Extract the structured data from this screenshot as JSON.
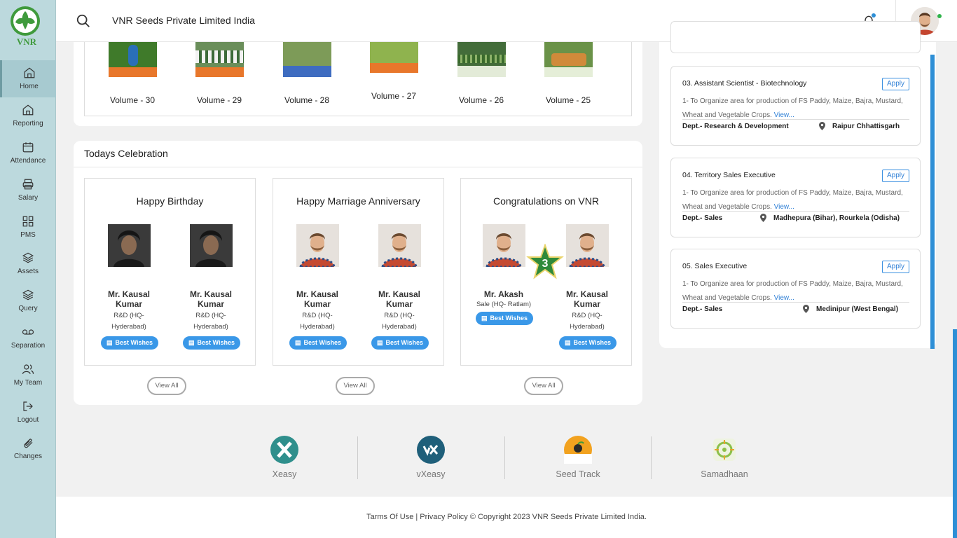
{
  "app": {
    "logo_text": "VNR",
    "company_name": "VNR Seeds Private Limited India"
  },
  "nav": [
    {
      "label": "Home",
      "icon": "home-icon"
    },
    {
      "label": "Reporting",
      "icon": "home-icon"
    },
    {
      "label": "Attendance",
      "icon": "calendar-icon"
    },
    {
      "label": "Salary",
      "icon": "printer-icon"
    },
    {
      "label": "PMS",
      "icon": "grid-icon"
    },
    {
      "label": "Assets",
      "icon": "layers-icon"
    },
    {
      "label": "Query",
      "icon": "layers-icon"
    },
    {
      "label": "Separation",
      "icon": "voicemail-icon"
    },
    {
      "label": "My Team",
      "icon": "users-icon"
    },
    {
      "label": "Logout",
      "icon": "logout-icon"
    },
    {
      "label": "Changes",
      "icon": "paperclip-icon"
    }
  ],
  "magazines": [
    {
      "label": "Volume - 30"
    },
    {
      "label": "Volume - 29"
    },
    {
      "label": "Volume - 28"
    },
    {
      "label": "Volume - 27"
    },
    {
      "label": "Volume - 26"
    },
    {
      "label": "Volume - 25"
    }
  ],
  "celebration": {
    "title": "Todays Celebration",
    "wish_label": "Best Wishes",
    "view_all": "View All",
    "badge_number": "3",
    "boxes": [
      {
        "heading": "Happy Birthday",
        "people": [
          {
            "name": "Mr. Kausal Kumar",
            "dept": "R&D (HQ-Hyderabad)"
          },
          {
            "name": "Mr. Kausal Kumar",
            "dept": "R&D (HQ-Hyderabad)"
          }
        ]
      },
      {
        "heading": "Happy Marriage Anniversary",
        "people": [
          {
            "name": "Mr. Kausal Kumar",
            "dept": "R&D (HQ-Hyderabad)"
          },
          {
            "name": "Mr. Kausal Kumar",
            "dept": "R&D (HQ-Hyderabad)"
          }
        ]
      },
      {
        "heading": "Congratulations on VNR",
        "people": [
          {
            "name": "Mr. Akash",
            "dept": "Sale (HQ- Ratlam)"
          },
          {
            "name": "Mr. Kausal Kumar",
            "dept": "R&D (HQ-Hyderabad)"
          }
        ]
      }
    ]
  },
  "jobs": [
    {
      "title": "03. Assistant Scientist - Biotechnology",
      "apply": "Apply",
      "desc": "1- To Organize area for production of FS Paddy, Maize, Bajra, Mustard, Wheat and Vegetable Crops.",
      "view": "View...",
      "dept": "Dept.- Research & Development",
      "location": "Raipur Chhattisgarh"
    },
    {
      "title": "04. Territory Sales Executive",
      "apply": "Apply",
      "desc": "1- To Organize area for production of FS Paddy, Maize, Bajra, Mustard, Wheat and Vegetable Crops.",
      "view": "View...",
      "dept": "Dept.- Sales",
      "location": "Madhepura (Bihar), Rourkela (Odisha)"
    },
    {
      "title": "05. Sales Executive",
      "apply": "Apply",
      "desc": "1- To Organize area for production of FS Paddy, Maize, Bajra, Mustard, Wheat and Vegetable Crops.",
      "view": "View...",
      "dept": "Dept.- Sales",
      "location": "Medinipur (West Bengal)"
    }
  ],
  "apps": [
    {
      "label": "Xeasy",
      "color": "#2f8f8c"
    },
    {
      "label": "vXeasy",
      "color": "#1f5f7a"
    },
    {
      "label": "Seed Track",
      "color": "#f0a020"
    },
    {
      "label": "Samadhaan",
      "color": "#8cc04a"
    }
  ],
  "footer": {
    "text": "Tarms Of Use | Privacy Policy © Copyright 2023 VNR Seeds Private Limited India."
  }
}
